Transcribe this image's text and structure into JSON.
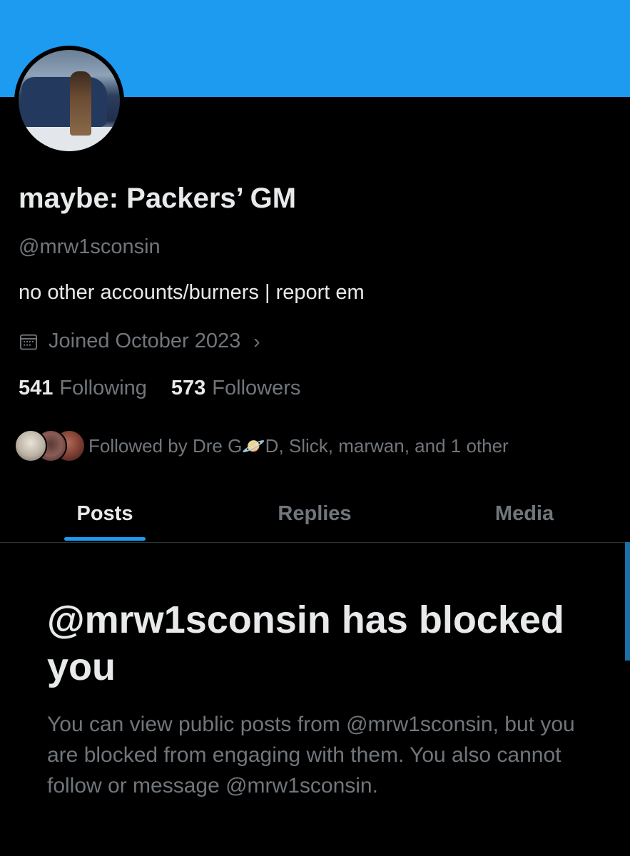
{
  "colors": {
    "background": "#000000",
    "banner": "#1d9bf0",
    "accent": "#1d9bf0",
    "primary_text": "#e7e9ea",
    "secondary_text": "#71767b",
    "divider": "#2f3336"
  },
  "profile": {
    "display_name": "maybe: Packers’ GM",
    "handle": "@mrw1sconsin",
    "bio": "no other accounts/burners | report em",
    "joined": {
      "icon": "calendar-icon",
      "text": "Joined October 2023",
      "chevron": "›"
    },
    "following_count": "541",
    "following_label": "Following",
    "followers_count": "573",
    "followers_label": "Followers",
    "followed_by": "Followed by Dre G🪐D, Slick, marwan, and 1 other"
  },
  "tabs": [
    {
      "label": "Posts",
      "active": true
    },
    {
      "label": "Replies",
      "active": false
    },
    {
      "label": "Media",
      "active": false
    }
  ],
  "blocked": {
    "title": "@mrw1sconsin has blocked you",
    "body": "You can view public posts from @mrw1sconsin, but you are blocked from engaging with them. You also cannot follow or message @mrw1sconsin."
  }
}
